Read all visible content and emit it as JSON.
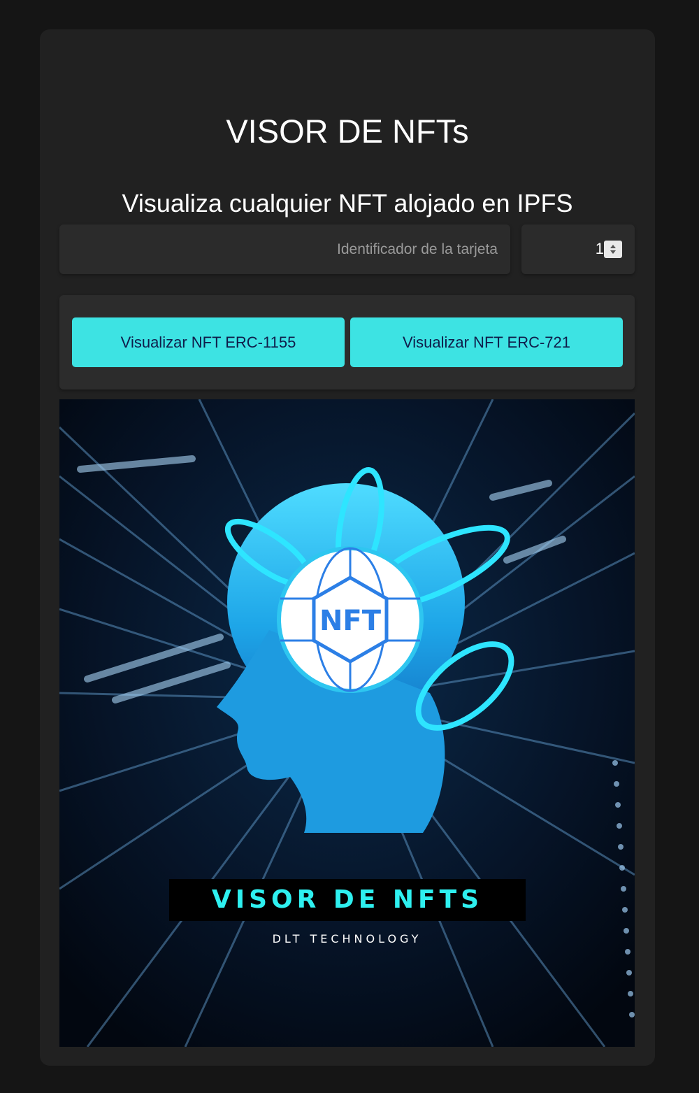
{
  "header": {
    "title": "VISOR DE NFTs",
    "subtitle": "Visualiza cualquier NFT alojado en IPFS"
  },
  "form": {
    "card_id_placeholder": "Identificador de la tarjeta",
    "card_id_value": "",
    "amount_value": "1"
  },
  "buttons": {
    "erc1155_label": "Visualizar NFT ERC-1155",
    "erc721_label": "Visualizar NFT ERC-721"
  },
  "nft_image": {
    "badge": "NFT",
    "banner_title": "VISOR DE NFTS",
    "banner_subtitle": "DLT TECHNOLOGY"
  },
  "colors": {
    "page_bg": "#151515",
    "card_bg": "#212121",
    "button_bg": "#3de3e3",
    "button_text": "#0f1d4a",
    "accent_cyan": "#2ef0f0"
  }
}
